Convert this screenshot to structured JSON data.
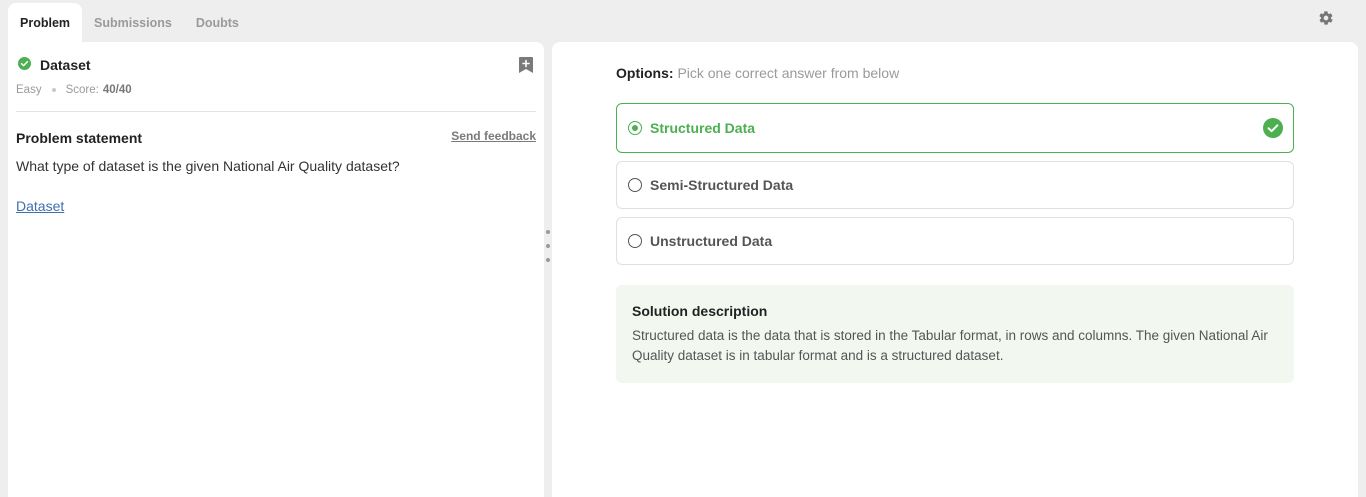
{
  "tabs": [
    {
      "label": "Problem",
      "active": true
    },
    {
      "label": "Submissions",
      "active": false
    },
    {
      "label": "Doubts",
      "active": false
    }
  ],
  "header": {
    "settings_icon": "gear-icon"
  },
  "problem": {
    "status_icon": "check-circle-icon",
    "title": "Dataset",
    "difficulty": "Easy",
    "score_label": "Score:",
    "score_value": "40/40",
    "bookmark_icon": "bookmark-add-icon",
    "statement_title": "Problem statement",
    "send_feedback": "Send feedback",
    "statement": "What type of dataset is the given National Air Quality dataset?",
    "link_text": "Dataset"
  },
  "options": {
    "label": "Options:",
    "hint": "Pick one correct answer from below",
    "items": [
      {
        "label": "Structured Data",
        "selected": true,
        "correct": true
      },
      {
        "label": "Semi-Structured Data",
        "selected": false,
        "correct": false
      },
      {
        "label": "Unstructured Data",
        "selected": false,
        "correct": false
      }
    ]
  },
  "solution": {
    "title": "Solution description",
    "text": "Structured data is the data that is stored in the Tabular format, in rows and columns. The given National Air Quality dataset is in tabular format and is a structured dataset."
  },
  "colors": {
    "accent_green": "#4caf50",
    "link_blue": "#3f6fb0",
    "solution_bg": "#f2f7f0",
    "page_bg": "#eeeeee"
  }
}
